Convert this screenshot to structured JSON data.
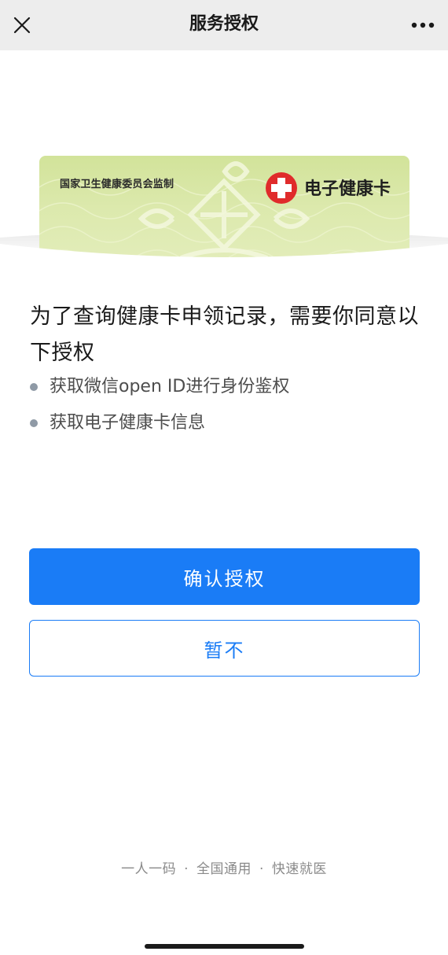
{
  "navbar": {
    "title": "服务授权",
    "close_icon": "close-icon",
    "more_icon": "more-dots-icon"
  },
  "card": {
    "issuer": "国家卫生健康委员会监制",
    "brand": "电子健康卡",
    "logo_icon": "red-cross-icon",
    "logo_color": "#e02b2b",
    "background_color": "#d8e7a6"
  },
  "content": {
    "headline": "为了查询健康卡申领记录，需要你同意以下授权",
    "permissions": [
      "获取微信open ID进行身份鉴权",
      "获取电子健康卡信息"
    ]
  },
  "buttons": {
    "confirm": "确认授权",
    "decline": "暂不",
    "accent_color": "#1a7cf6"
  },
  "footer": {
    "items": [
      "一人一码",
      "全国通用",
      "快速就医"
    ],
    "separator": "·"
  }
}
